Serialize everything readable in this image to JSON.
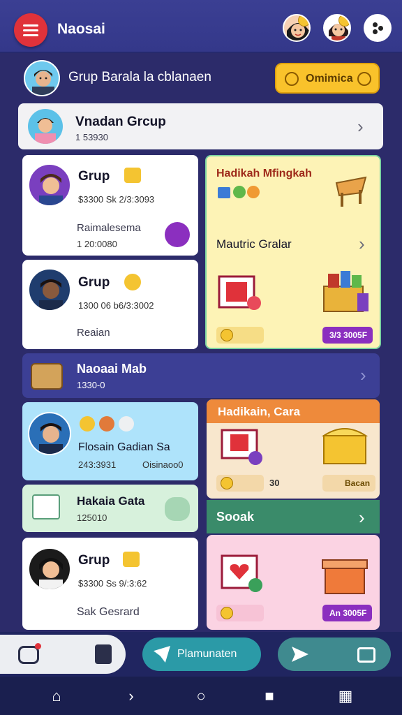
{
  "app": {
    "title": "Naosai"
  },
  "header": {
    "text": "Grup Barala la cblanaen",
    "contact_button": "Omimica"
  },
  "group_list": [
    {
      "title": "Vnadan Grcup",
      "subtitle": "1 53930"
    }
  ],
  "member_cards": [
    {
      "title": "Grup",
      "stats": "$3300 Sk 2/3:3093",
      "name": "Raimalesema",
      "code": "1 20:0080"
    },
    {
      "title": "Grup",
      "stats": "1300 06 b6/3:3002",
      "name": "Reaian"
    }
  ],
  "promo_yellow": {
    "title": "Hadikah Mfingkah",
    "item_label": "Mautric Gralar",
    "pill": "3/3 3005F"
  },
  "banner": {
    "title": "Naoaai Mab",
    "subtitle": "1330-0"
  },
  "promo_orange": {
    "title": "Hadikain, Cara",
    "count": "30",
    "right_label": "Bacan"
  },
  "list_cards": [
    {
      "title": "Flosain Gadian Sa",
      "stats": "243:3931",
      "badge": "Oisinaoo0"
    },
    {
      "title": "Hakaia Gata",
      "code": "125010"
    },
    {
      "title": "Grup",
      "stats": "$3300 Ss 9/:3:62",
      "name": "Sak Gesrard"
    }
  ],
  "social": {
    "label": "Sooak"
  },
  "pink_card": {
    "pill": "An 3005F"
  },
  "actions": {
    "main_button": "Plamunaten"
  },
  "colors": {
    "top_bar": "#3b3f93",
    "accent_red": "#e0323a",
    "accent_yellow": "#f9c22b",
    "teal": "#2b9aa7",
    "purple": "#8b2fbf",
    "green": "#3a8b6a",
    "orange": "#ee8a3b"
  },
  "icons": [
    "menu-icon",
    "coin-icon",
    "more-icon",
    "chat-icon",
    "chevron-right-icon",
    "camera-icon",
    "phone-icon",
    "send-icon",
    "cart-icon",
    "home-icon",
    "back-icon",
    "circle-home-icon",
    "square-icon",
    "grid-icon"
  ]
}
